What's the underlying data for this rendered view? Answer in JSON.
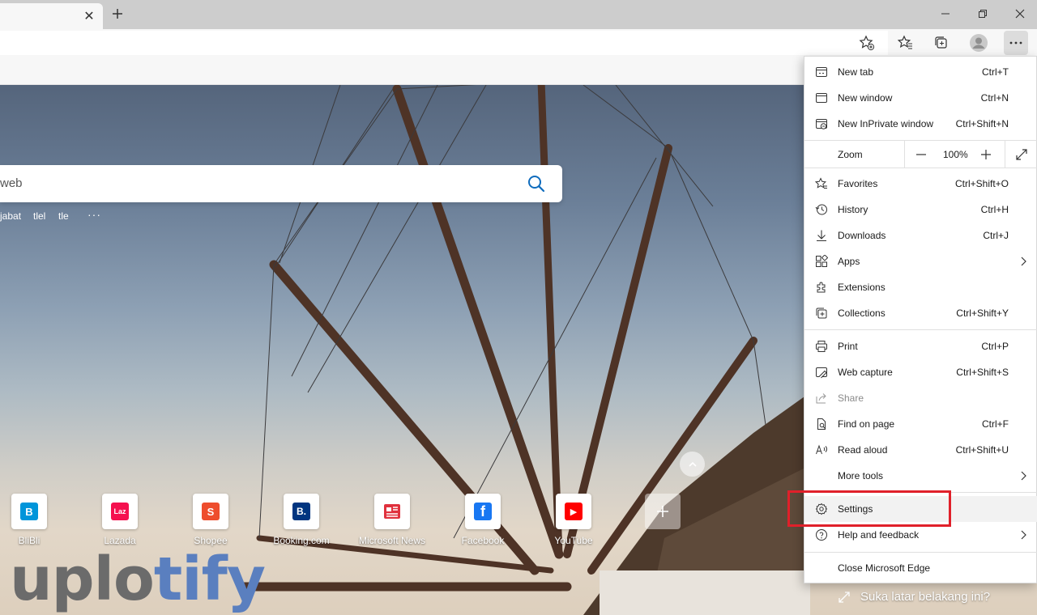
{
  "window": {
    "tab_close_glyph": "✕",
    "new_tab_glyph": "+",
    "controls": [
      "minimize-icon",
      "restore-icon",
      "close-icon"
    ]
  },
  "toolbar": {
    "icons": [
      "add-favorite-icon",
      "favorites-icon",
      "collections-icon",
      "profile-icon",
      "more-icon"
    ]
  },
  "search": {
    "query_text": "web",
    "trending": [
      "jabat",
      "tlel",
      "tle"
    ],
    "more_label": "···"
  },
  "quick_links": [
    {
      "name": "BliBli",
      "icon": "blibli-icon",
      "color": "#0095da",
      "glyph": "B"
    },
    {
      "name": "Lazada",
      "icon": "lazada-icon",
      "color": "#f5114f",
      "glyph": "Laz"
    },
    {
      "name": "Shopee",
      "icon": "shopee-icon",
      "color": "#ee4d2d",
      "glyph": "S"
    },
    {
      "name": "Booking.com",
      "icon": "booking-icon",
      "color": "#003580",
      "glyph": "B."
    },
    {
      "name": "Microsoft News",
      "icon": "microsoft-news-icon",
      "color": "#e0313d",
      "glyph": ""
    },
    {
      "name": "Facebook",
      "icon": "facebook-icon",
      "color": "#1877f2",
      "glyph": "f"
    },
    {
      "name": "YouTube",
      "icon": "youtube-icon",
      "color": "#ff0000",
      "glyph": "▶"
    }
  ],
  "watermark": {
    "part_a": "uplo",
    "part_b": "tify"
  },
  "background_question": "Suka latar belakang ini?",
  "menu": {
    "items_top": [
      {
        "label": "New tab",
        "shortcut": "Ctrl+T",
        "icon": "new-tab-icon"
      },
      {
        "label": "New window",
        "shortcut": "Ctrl+N",
        "icon": "new-window-icon"
      },
      {
        "label": "New InPrivate window",
        "shortcut": "Ctrl+Shift+N",
        "icon": "inprivate-icon"
      }
    ],
    "zoom": {
      "label": "Zoom",
      "value": "100%",
      "minus": "−",
      "plus": "+"
    },
    "items_mid": [
      {
        "label": "Favorites",
        "shortcut": "Ctrl+Shift+O",
        "icon": "favorites-star-icon"
      },
      {
        "label": "History",
        "shortcut": "Ctrl+H",
        "icon": "history-icon"
      },
      {
        "label": "Downloads",
        "shortcut": "Ctrl+J",
        "icon": "downloads-icon"
      },
      {
        "label": "Apps",
        "shortcut": "",
        "icon": "apps-icon",
        "submenu": true
      },
      {
        "label": "Extensions",
        "shortcut": "",
        "icon": "extensions-icon"
      },
      {
        "label": "Collections",
        "shortcut": "Ctrl+Shift+Y",
        "icon": "collections-menu-icon"
      }
    ],
    "items_tools": [
      {
        "label": "Print",
        "shortcut": "Ctrl+P",
        "icon": "print-icon"
      },
      {
        "label": "Web capture",
        "shortcut": "Ctrl+Shift+S",
        "icon": "web-capture-icon"
      },
      {
        "label": "Share",
        "shortcut": "",
        "icon": "share-icon",
        "disabled": true
      },
      {
        "label": "Find on page",
        "shortcut": "Ctrl+F",
        "icon": "find-icon"
      },
      {
        "label": "Read aloud",
        "shortcut": "Ctrl+Shift+U",
        "icon": "read-aloud-icon"
      },
      {
        "label": "More tools",
        "shortcut": "",
        "icon": "",
        "submenu": true
      }
    ],
    "items_bottom": [
      {
        "label": "Settings",
        "shortcut": "",
        "icon": "settings-icon"
      },
      {
        "label": "Help and feedback",
        "shortcut": "",
        "icon": "help-icon",
        "submenu": true
      }
    ],
    "close_label": "Close Microsoft Edge"
  },
  "colors": {
    "highlight": "#e0202a",
    "menu_bg": "#ffffff",
    "tabstrip": "#cdcdcd"
  }
}
